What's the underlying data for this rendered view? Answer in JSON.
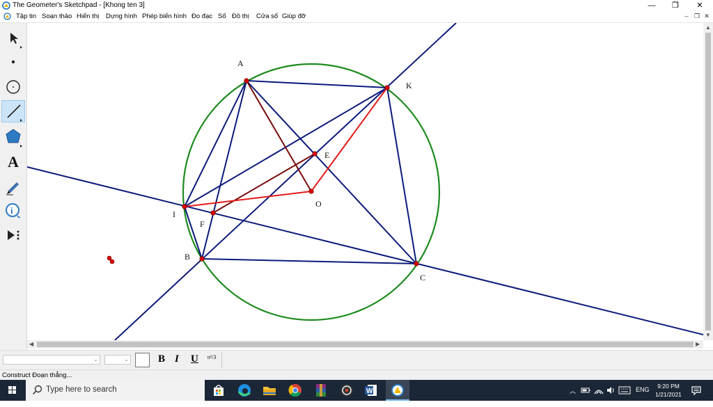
{
  "window": {
    "title": "The Geometer's Sketchpad - [Khong ten 3]",
    "minimize_glyph": "—",
    "restore_glyph": "❐",
    "close_glyph": "✕"
  },
  "menu": {
    "items": [
      "Tập tin",
      "Soạn thảo",
      "Hiển thị",
      "Dựng hình",
      "Phép biến hình",
      "Đo đạc",
      "Số",
      "Đồ thị",
      "Cửa sổ",
      "Giúp đỡ"
    ],
    "mdi": {
      "minimize": "–",
      "restore": "❐",
      "close": "✕"
    }
  },
  "tools": [
    {
      "name": "arrow-select-tool",
      "selected": false
    },
    {
      "name": "point-tool",
      "selected": false
    },
    {
      "name": "compass-tool",
      "selected": false
    },
    {
      "name": "straightedge-tool",
      "selected": true
    },
    {
      "name": "polygon-tool",
      "selected": false
    },
    {
      "name": "text-tool",
      "glyph": "A",
      "selected": false
    },
    {
      "name": "marker-tool",
      "selected": false
    },
    {
      "name": "information-tool",
      "glyph": "i",
      "selected": false
    },
    {
      "name": "custom-tool",
      "selected": false
    }
  ],
  "sketch": {
    "colors": {
      "navy": "#0b1a7a",
      "green": "#1c8a1c",
      "red": "#e41b1b",
      "darkred": "#7a0a0a",
      "point": "#d40000"
    },
    "labels": {
      "A": "A",
      "K": "K",
      "E": "E",
      "O": "O",
      "I": "I",
      "F": "F",
      "B": "B",
      "C": "C"
    }
  },
  "format": {
    "bold": "B",
    "italic": "I",
    "underline": "U",
    "symbol": "π²/3"
  },
  "status": {
    "text": "Construct Đoạn thẳng..."
  },
  "taskbar": {
    "search_placeholder": "Type here to search",
    "apps": [
      "windows-store-icon",
      "edge-icon",
      "file-explorer-icon",
      "chrome-icon",
      "winrar-icon",
      "media-player-icon",
      "word-icon",
      "sketchpad-icon"
    ],
    "language": "ENG",
    "time": "9:20 PM",
    "date": "1/21/2021"
  }
}
